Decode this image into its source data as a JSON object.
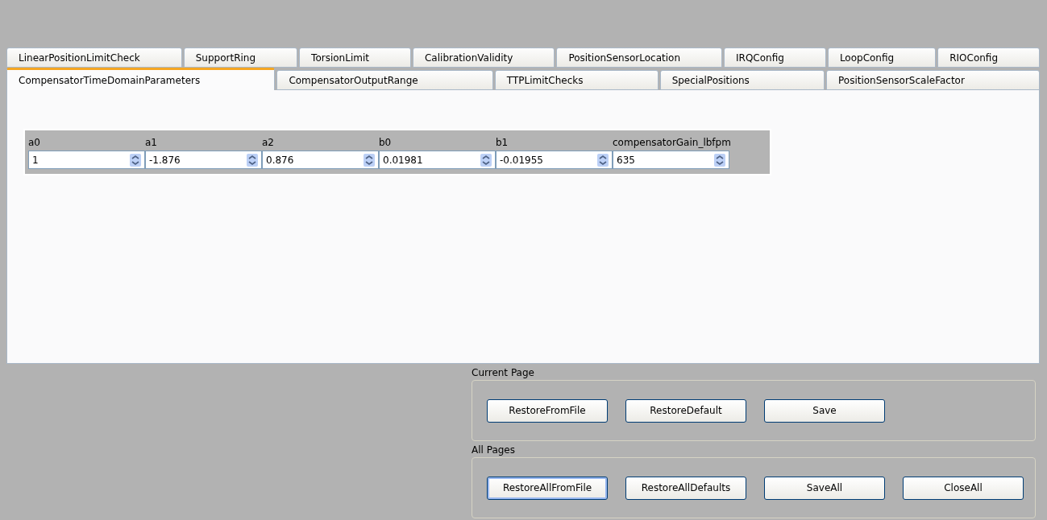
{
  "tab_rows": [
    [
      {
        "label": "LinearPositionLimitCheck",
        "selected": false
      },
      {
        "label": "SupportRing",
        "selected": false
      },
      {
        "label": "TorsionLimit",
        "selected": false
      },
      {
        "label": "CalibrationValidity",
        "selected": false
      },
      {
        "label": "PositionSensorLocation",
        "selected": false
      },
      {
        "label": "IRQConfig",
        "selected": false
      },
      {
        "label": "LoopConfig",
        "selected": false
      },
      {
        "label": "RIOConfig",
        "selected": false
      }
    ],
    [
      {
        "label": "CompensatorTimeDomainParameters",
        "selected": true
      },
      {
        "label": "CompensatorOutputRange",
        "selected": false
      },
      {
        "label": "TTPLimitChecks",
        "selected": false
      },
      {
        "label": "SpecialPositions",
        "selected": false
      },
      {
        "label": "PositionSensorScaleFactor",
        "selected": false
      }
    ]
  ],
  "parameters": [
    {
      "label": "a0",
      "value": "1"
    },
    {
      "label": "a1",
      "value": "-1.876"
    },
    {
      "label": "a2",
      "value": "0.876"
    },
    {
      "label": "b0",
      "value": "0.01981"
    },
    {
      "label": "b1",
      "value": "-0.01955"
    },
    {
      "label": "compensatorGain_lbfpm",
      "value": "635"
    }
  ],
  "groups": [
    {
      "title": "Current Page",
      "buttons": [
        {
          "label": "RestoreFromFile",
          "focused": false
        },
        {
          "label": "RestoreDefault",
          "focused": false
        },
        {
          "label": "Save",
          "focused": false
        }
      ]
    },
    {
      "title": "All Pages",
      "buttons": [
        {
          "label": "RestoreAllFromFile",
          "focused": true
        },
        {
          "label": "RestoreAllDefaults",
          "focused": false
        },
        {
          "label": "SaveAll",
          "focused": false
        },
        {
          "label": "CloseAll",
          "focused": false
        }
      ]
    }
  ]
}
